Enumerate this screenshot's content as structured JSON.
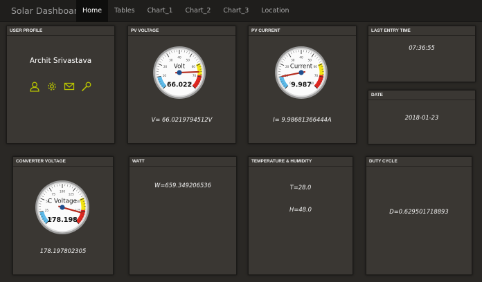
{
  "app": {
    "brand": "Solar Dashboard",
    "tabs": [
      {
        "label": "Home",
        "active": true
      },
      {
        "label": "Tables",
        "active": false
      },
      {
        "label": "Chart_1",
        "active": false
      },
      {
        "label": "Chart_2",
        "active": false
      },
      {
        "label": "Chart_3",
        "active": false
      },
      {
        "label": "Location",
        "active": false
      }
    ]
  },
  "colors": {
    "background": "#2a2825",
    "panel": "#3a3733",
    "navbar": "#1f1e1c",
    "icon_accent": "#b8c400",
    "gauge_red": "#e0261f",
    "gauge_yellow": "#f2e313",
    "gauge_blue": "#5cb9e8"
  },
  "profile": {
    "title": "USER PROFILE",
    "name": "Archit Srivastava",
    "icons": [
      "user-icon",
      "gear-icon",
      "envelope-icon",
      "wrench-icon"
    ]
  },
  "pv_voltage": {
    "title": "PV VOLTAGE",
    "gauge_label": "Volt",
    "gauge_reading": "66.022",
    "gauge_value": 66.022,
    "gauge_min": 0,
    "gauge_max": 80,
    "reading": "V= 66.0219794512V"
  },
  "pv_current": {
    "title": "PV CURRENT",
    "gauge_label": "Current",
    "gauge_reading": "9.987",
    "gauge_value": 9.987,
    "gauge_min": 0,
    "gauge_max": 80,
    "reading": "I= 9.98681366444A"
  },
  "last_entry": {
    "title": "LAST ENTRY TIME",
    "value": "07:36:55"
  },
  "date": {
    "title": "DATE",
    "value": "2018-01-23"
  },
  "converter_voltage": {
    "title": "CONVERTER VOLTAGE",
    "gauge_label": "C Voltage",
    "gauge_reading": "178.198",
    "gauge_value": 178.198,
    "gauge_min": 0,
    "gauge_max": 200,
    "reading": "178.197802305"
  },
  "watt": {
    "title": "WATT",
    "value": "W=659.349206536"
  },
  "temp_humidity": {
    "title": "TEMPERATURE & HUMIDITY",
    "temperature": "T=28.0",
    "humidity": "H=48.0"
  },
  "duty_cycle": {
    "title": "DUTY CYCLE",
    "value": "D=0.629501718893"
  }
}
